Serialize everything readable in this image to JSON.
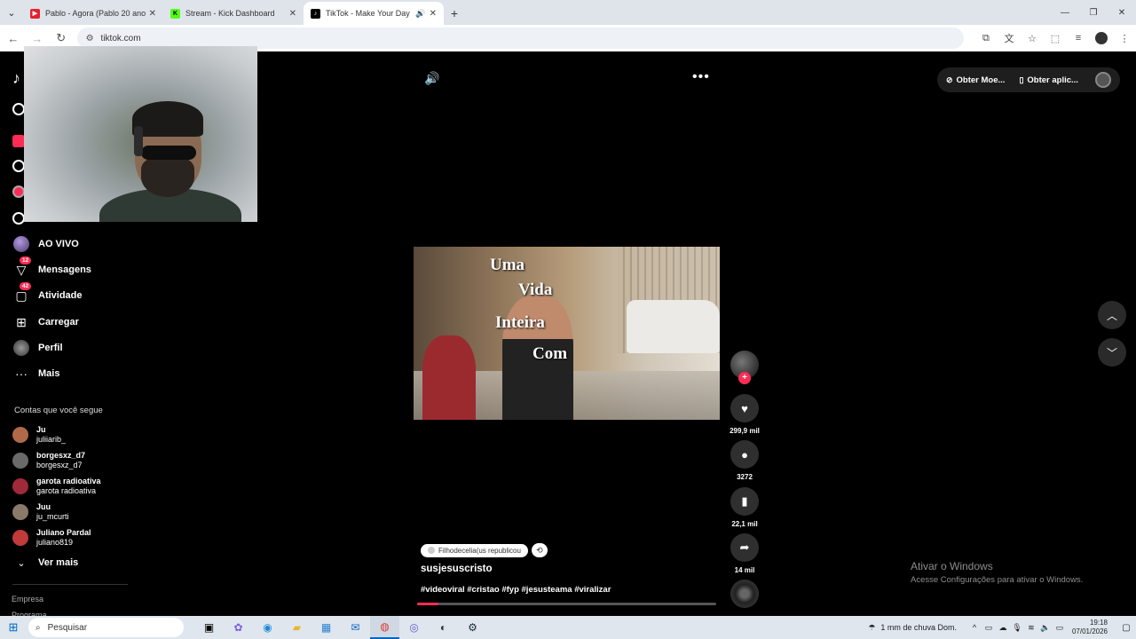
{
  "browser": {
    "tabs": [
      {
        "title": "Pablo - Agora (Pablo 20 anos) -",
        "favicon_color": "#e5202e",
        "active": false
      },
      {
        "title": "Stream - Kick Dashboard",
        "favicon_color": "#53fc18",
        "active": false
      },
      {
        "title": "TikTok - Make Your Day",
        "favicon_color": "#000000",
        "active": true
      }
    ],
    "url": "tiktok.com"
  },
  "sidebar": {
    "items": [
      {
        "label": "AO VIVO",
        "icon": "live-avatar-icon",
        "badge": ""
      },
      {
        "label": "Mensagens",
        "icon": "messages-icon",
        "badge": "12"
      },
      {
        "label": "Atividade",
        "icon": "activity-icon",
        "badge": "42"
      },
      {
        "label": "Carregar",
        "icon": "upload-icon",
        "badge": ""
      },
      {
        "label": "Perfil",
        "icon": "profile-icon",
        "badge": ""
      },
      {
        "label": "Mais",
        "icon": "more-icon",
        "badge": ""
      }
    ],
    "following_title": "Contas que você segue",
    "following": [
      {
        "name": "Ju",
        "handle": "juliiarib_",
        "color": "#b06a4a"
      },
      {
        "name": "borgesxz_d7",
        "handle": "borgesxz_d7",
        "color": "#6a6a6a"
      },
      {
        "name": "garota radioativa",
        "handle": "garota radioativa",
        "color": "#a02a3a"
      },
      {
        "name": "Juu",
        "handle": "ju_mcurti",
        "color": "#8a7a6a"
      },
      {
        "name": "Juliano Pardal",
        "handle": "juliano819",
        "color": "#c23a3a"
      }
    ],
    "see_more": "Ver mais",
    "footer_link": "Empresa",
    "footer_link2": "Programa"
  },
  "header": {
    "get_coins": "Obter Moe...",
    "get_app": "Obter aplic..."
  },
  "video": {
    "caption_lines": [
      "Uma",
      "Vida",
      "Inteira",
      "Com"
    ],
    "reposted_by": "Filhodecelia(us republicou",
    "author": "susjesuscristo",
    "hashtags": "#videoviral #cristao #fyp #jesusteama #viralizar",
    "progress_fraction": 0.07
  },
  "actions": {
    "likes": "299,9 mil",
    "comments": "3272",
    "saves": "22,1 mil",
    "shares": "14 mil"
  },
  "watermark": {
    "line1": "Ativar o Windows",
    "line2": "Acesse Configurações para ativar o Windows."
  },
  "taskbar": {
    "search_placeholder": "Pesquisar",
    "weather": "1 mm de chuva Dom.",
    "time": "19:18",
    "date": "07/01/2026"
  }
}
